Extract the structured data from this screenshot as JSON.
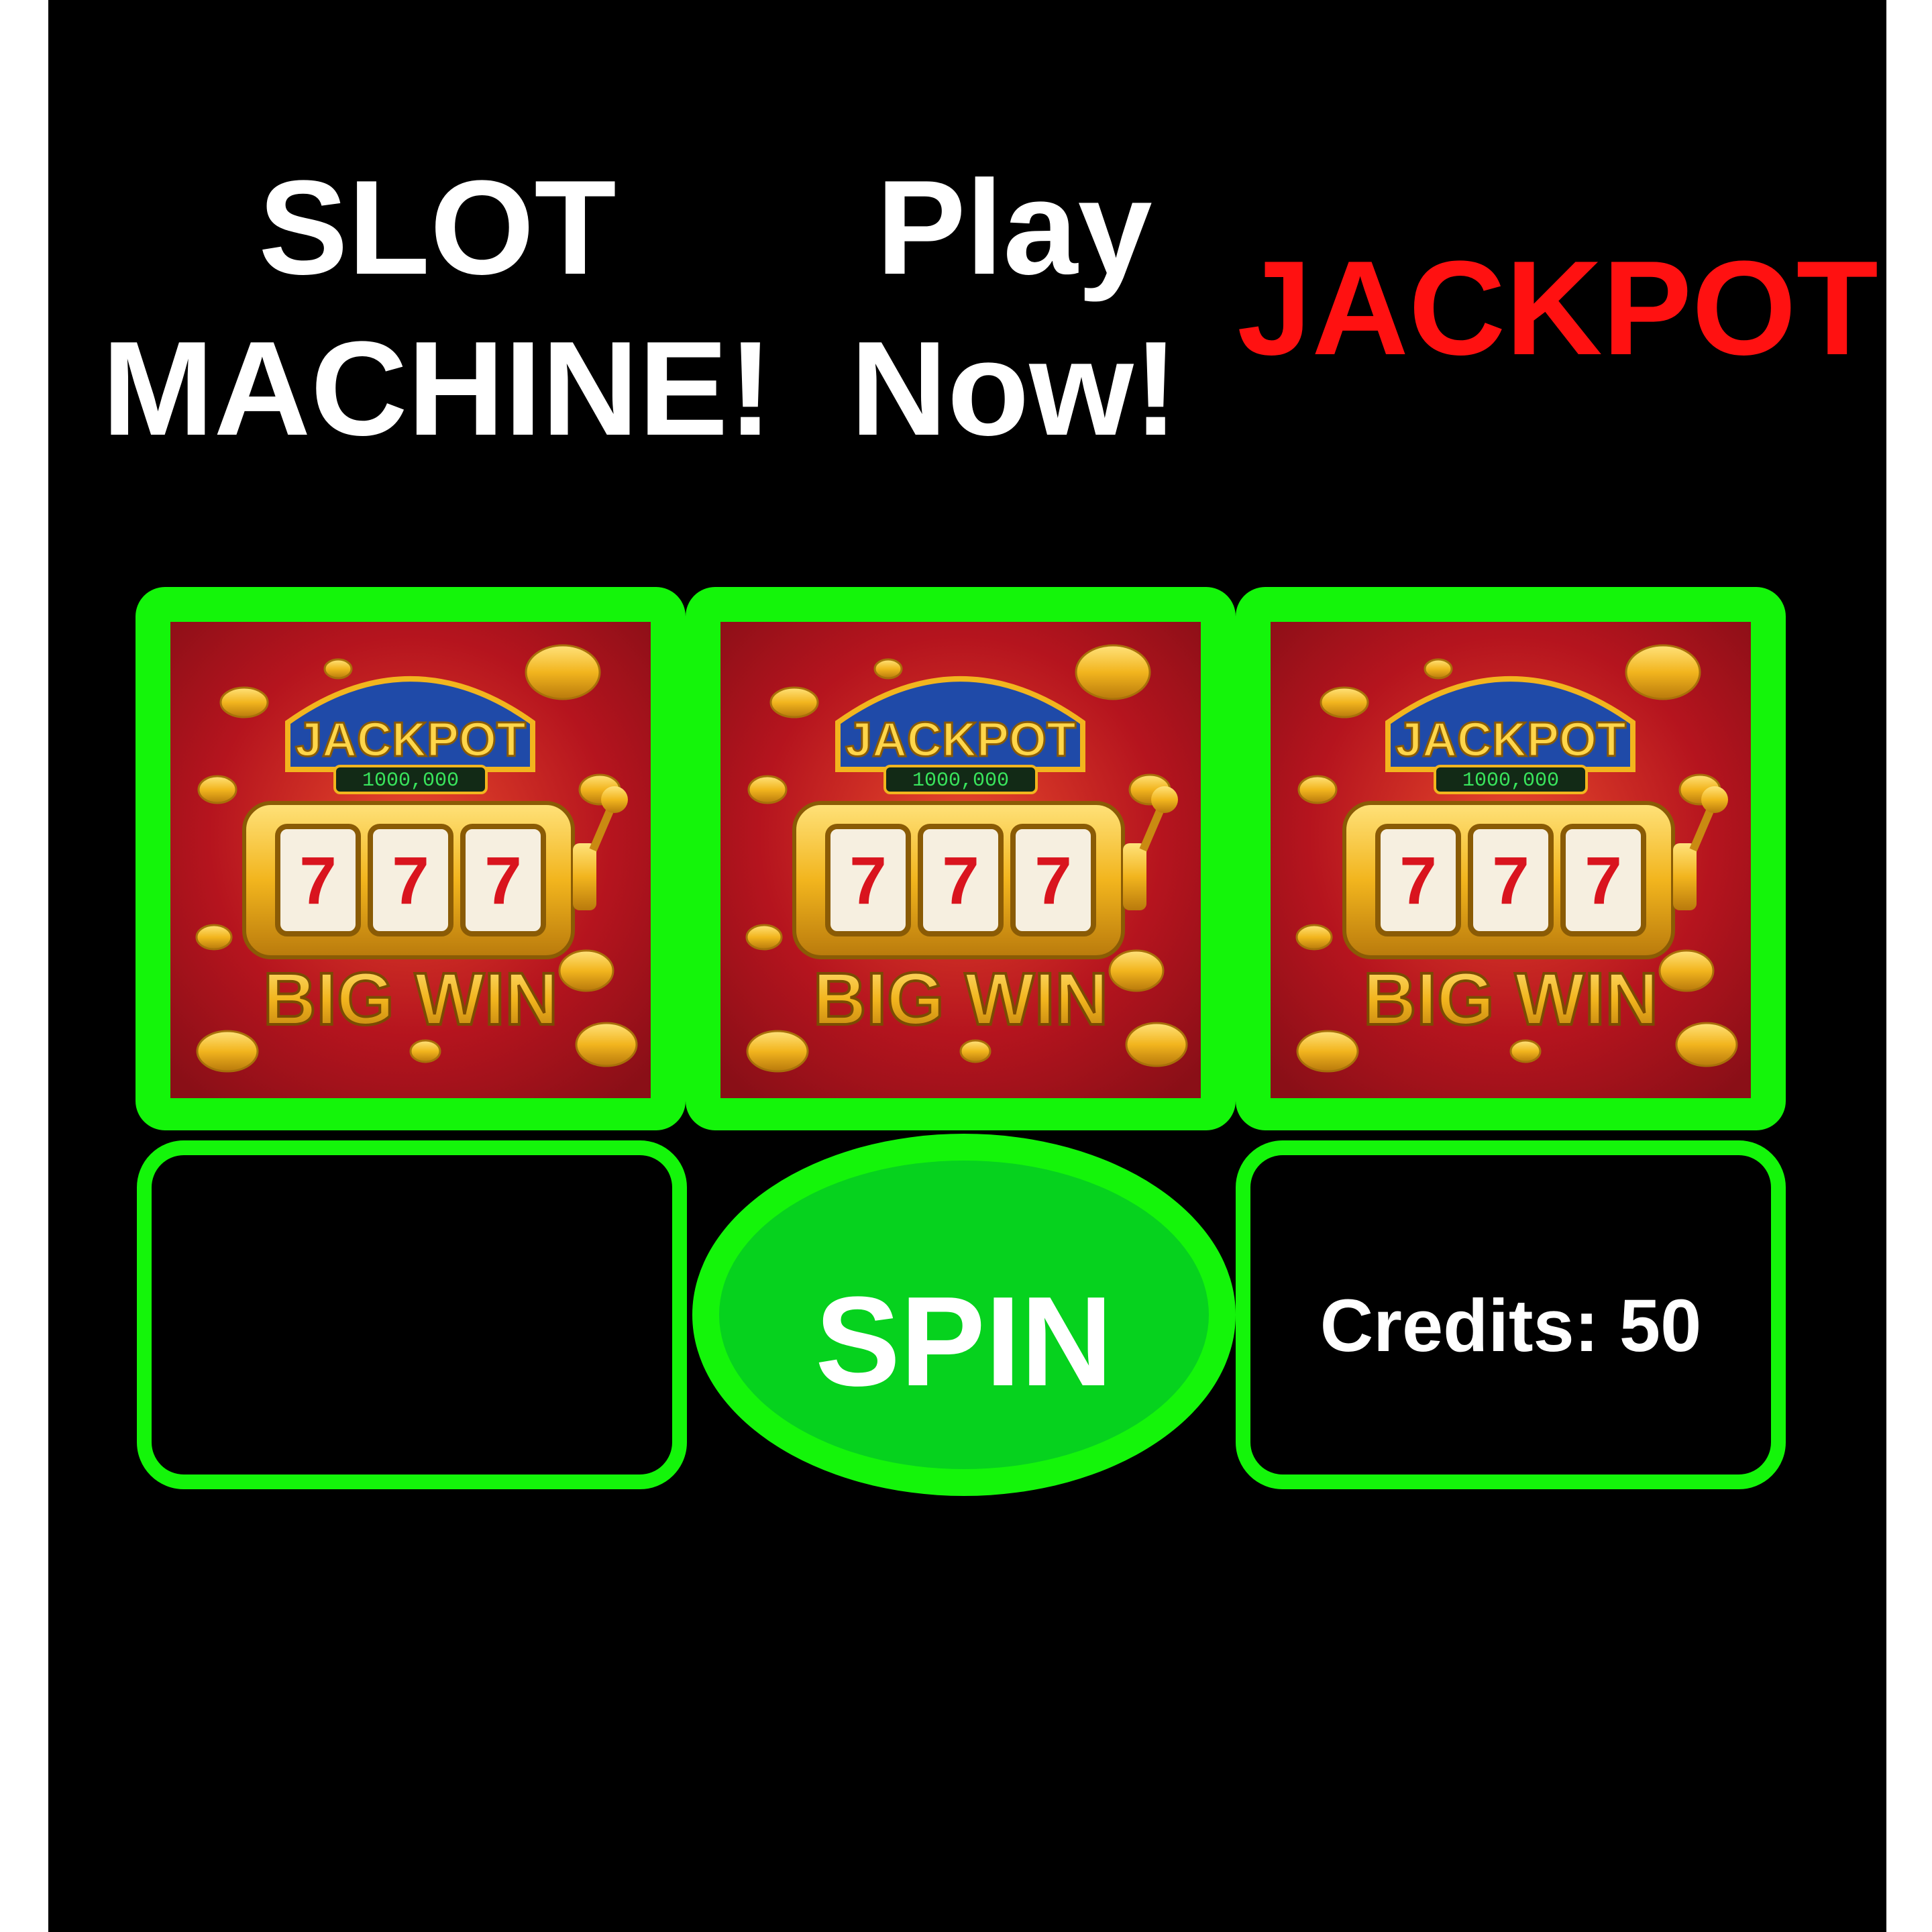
{
  "header": {
    "title_line1": "SLOT",
    "title_line2": "MACHINE!",
    "play_line1": "Play",
    "play_line2": "Now!",
    "jackpot": "JACKPOT"
  },
  "reels": [
    {
      "banner": "JACKPOT",
      "counter": "1000,000",
      "symbols": [
        "7",
        "7",
        "7"
      ],
      "caption": "BIG WIN"
    },
    {
      "banner": "JACKPOT",
      "counter": "1000,000",
      "symbols": [
        "7",
        "7",
        "7"
      ],
      "caption": "BIG WIN"
    },
    {
      "banner": "JACKPOT",
      "counter": "1000,000",
      "symbols": [
        "7",
        "7",
        "7"
      ],
      "caption": "BIG WIN"
    }
  ],
  "controls": {
    "spin_label": "SPIN",
    "credits_text": "Credits: 50"
  },
  "colors": {
    "background": "#000000",
    "accent_green": "#14f50a",
    "spin_fill": "#06d21e",
    "jackpot_red": "#ff1111",
    "reel_background": "#a9141d",
    "gold": "#f2b51e"
  },
  "icons": [
    "jackpot-slot-machine-icon",
    "gold-coin-icon"
  ]
}
